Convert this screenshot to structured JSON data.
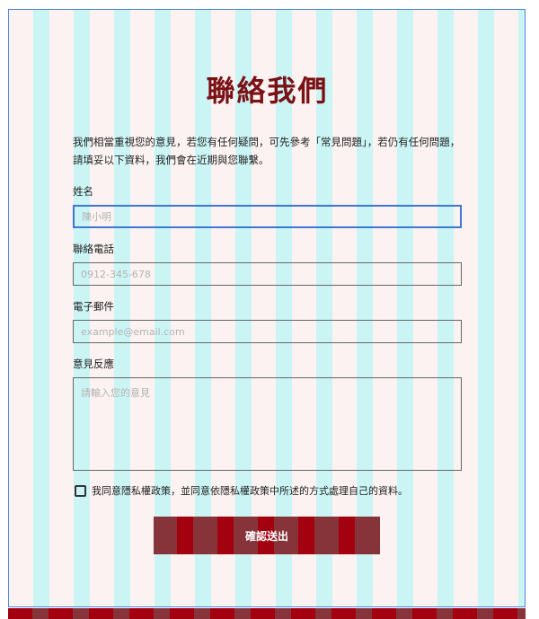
{
  "page": {
    "title": "聯絡我們",
    "intro": "我們相當重視您的意見，若您有任何疑問，可先參考「常見問題」，若仍有任何問題，請填妥以下資料，我們會在近期與您聯繫。"
  },
  "form": {
    "name": {
      "label": "姓名",
      "placeholder": "陳小明",
      "value": ""
    },
    "phone": {
      "label": "聯絡電話",
      "placeholder": "0912-345-678",
      "value": ""
    },
    "email": {
      "label": "電子郵件",
      "placeholder": "example@email.com",
      "value": ""
    },
    "feedback": {
      "label": "意見反應",
      "placeholder": "請輸入您的意見",
      "value": ""
    },
    "agree": {
      "label": "我同意隱私權政策，並同意依隱私權政策中所述的方式處理自己的資料。",
      "checked": false
    },
    "submit_label": "確認送出"
  },
  "colors": {
    "title": "#7a1115",
    "button": "#a30010",
    "focus_border": "#3f76d6",
    "grid_pink": "#fcf2f2",
    "grid_cyan": "#cbf5f5"
  }
}
